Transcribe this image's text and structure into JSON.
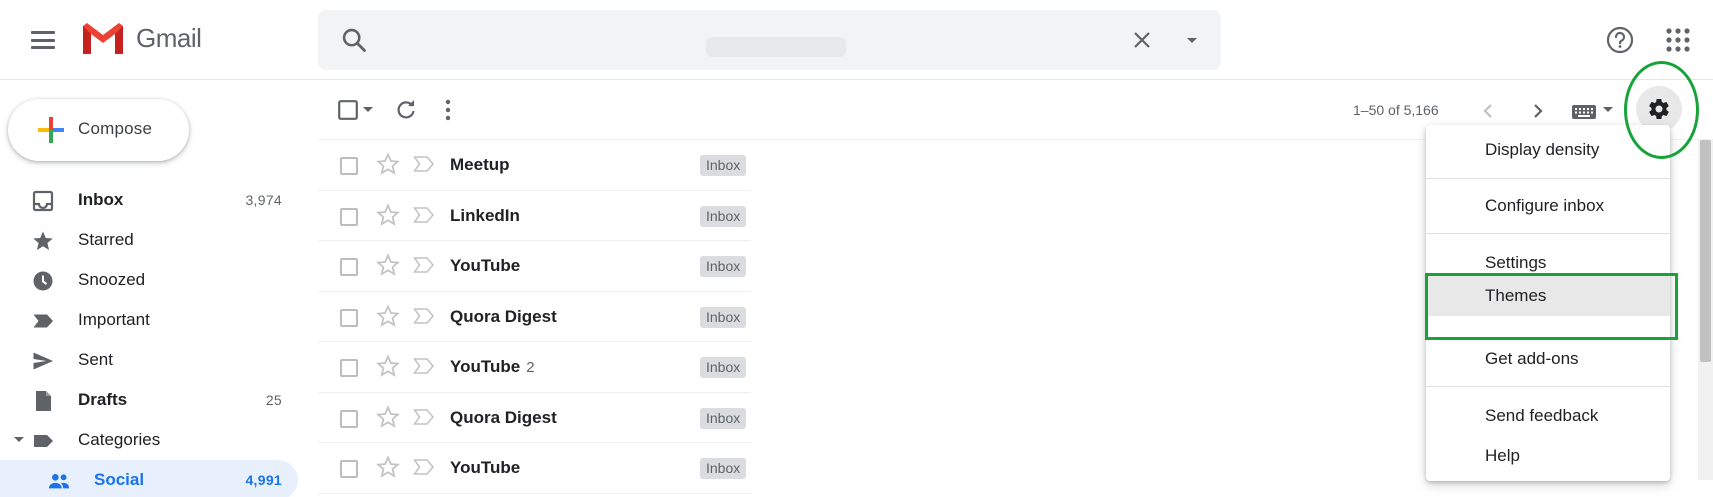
{
  "app": {
    "name": "Gmail"
  },
  "search": {
    "value": "",
    "placeholder": ""
  },
  "sidebar": {
    "compose_label": "Compose",
    "items": [
      {
        "label": "Inbox",
        "count": "3,974",
        "icon": "inbox-icon"
      },
      {
        "label": "Starred",
        "count": "",
        "icon": "star-icon"
      },
      {
        "label": "Snoozed",
        "count": "",
        "icon": "clock-icon"
      },
      {
        "label": "Important",
        "count": "",
        "icon": "important-icon"
      },
      {
        "label": "Sent",
        "count": "",
        "icon": "send-icon"
      },
      {
        "label": "Drafts",
        "count": "25",
        "icon": "draft-icon"
      },
      {
        "label": "Categories",
        "count": "",
        "icon": "label-icon"
      },
      {
        "label": "Social",
        "count": "4,991",
        "icon": "people-icon"
      }
    ]
  },
  "toolbar": {
    "pager": "1–50 of 5,166"
  },
  "mails": [
    {
      "sender": "Meetup",
      "count": "",
      "label": "Inbox"
    },
    {
      "sender": "LinkedIn",
      "count": "",
      "label": "Inbox"
    },
    {
      "sender": "YouTube",
      "count": "",
      "label": "Inbox"
    },
    {
      "sender": "Quora Digest",
      "count": "",
      "label": "Inbox"
    },
    {
      "sender": "YouTube",
      "count": "2",
      "label": "Inbox"
    },
    {
      "sender": "Quora Digest",
      "count": "",
      "label": "Inbox"
    },
    {
      "sender": "YouTube",
      "count": "",
      "label": "Inbox"
    }
  ],
  "settings_menu": {
    "items": [
      "Display density",
      "Configure inbox",
      "Settings",
      "Themes",
      "Get add-ons",
      "Send feedback",
      "Help"
    ]
  },
  "colors": {
    "accent": "#1a73e8",
    "annotation": "#18a33a",
    "active_nav_bg": "#e8f0fe"
  }
}
